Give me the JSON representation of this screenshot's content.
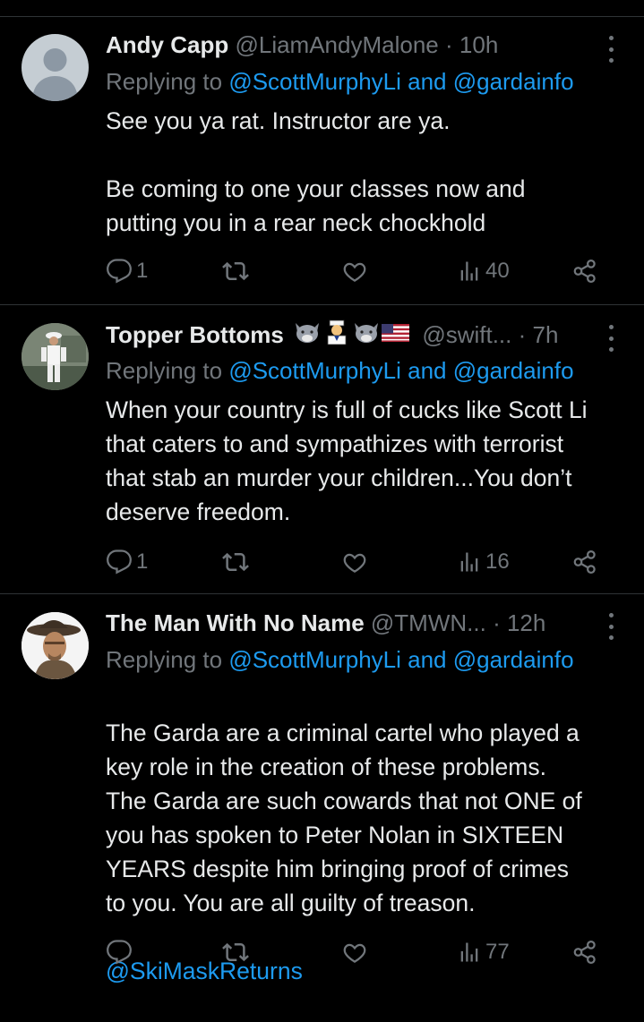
{
  "tweets": [
    {
      "name": "Andy Capp",
      "handle": "@LiamAndyMalone",
      "sep": "·",
      "time": "10h",
      "replying_prefix": "Replying to",
      "replying_to": "@ScottMurphyLi and @gardainfo",
      "body": "See you ya rat. Instructor are ya.\n\nBe coming to one your classes now and\nputting you in a rear neck chockhold",
      "mention": "",
      "reply_count": "1",
      "retweet_count": "",
      "like_count": "",
      "views": "40"
    },
    {
      "name": "Topper Bottoms",
      "handle": "@swift...",
      "sep": "·",
      "time": "7h",
      "replying_prefix": "Replying to",
      "replying_to": "@ScottMurphyLi and @gardainfo",
      "body": "When your country is full of cucks like Scott Li\nthat caters to and sympathizes with terrorist\nthat stab an murder your children...You don’t\ndeserve freedom.",
      "mention": "",
      "reply_count": "1",
      "retweet_count": "",
      "like_count": "",
      "views": "16"
    },
    {
      "name": "The Man With No Name",
      "handle": "@TMWN...",
      "sep": "·",
      "time": "12h",
      "replying_prefix": "Replying to",
      "replying_to": "@ScottMurphyLi and @gardainfo",
      "body": "The Garda are a criminal cartel who played a\nkey role in the creation of these problems.\nThe Garda are such cowards that not ONE of\nyou has spoken to Peter Nolan in SIXTEEN\nYEARS despite him bringing proof of crimes\nto you. You are all guilty of treason.",
      "mention": "@SkiMaskReturns",
      "reply_count": "",
      "retweet_count": "",
      "like_count": "",
      "views": "77"
    }
  ],
  "icons": {
    "reply": "reply-icon",
    "retweet": "retweet-icon",
    "like": "heart-icon",
    "views": "views-icon",
    "share": "share-icon",
    "more": "more-icon"
  },
  "colors": {
    "background": "#000000",
    "text": "#e7e9ea",
    "muted": "#71767b",
    "link": "#1d9bf0",
    "divider": "#2f3336"
  }
}
